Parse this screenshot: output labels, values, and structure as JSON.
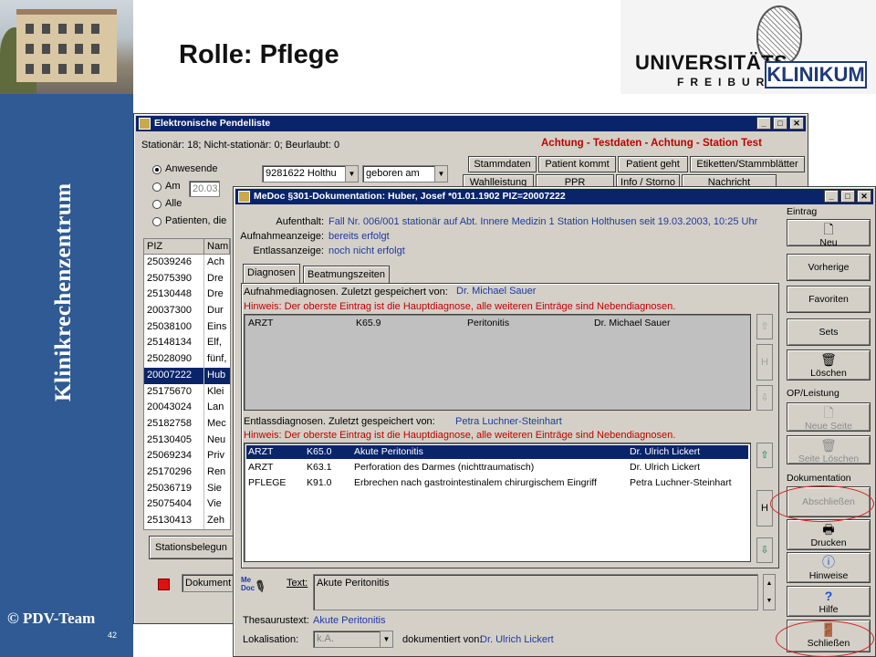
{
  "slide": {
    "title": "Rolle: Pflege",
    "side_title": "Klinikrechenzentrum",
    "copyright": "© PDV-Team",
    "page_number": "42",
    "logo": {
      "line1": "UNIVERSITÄTS",
      "line2": "FREIBURG",
      "line3": "KLINIKUM"
    }
  },
  "pendel": {
    "title": "Elektronische Pendelliste",
    "stats": "Stationär: 18; Nicht-stationär: 0; Beurlaubt: 0",
    "warning": "Achtung - Testdaten - Achtung - Station Test",
    "filter": {
      "options": [
        "Anwesende",
        "Am",
        "Alle",
        "Patienten, die"
      ],
      "date_value": "20.03.",
      "combo1": "9281622 Holthu",
      "combo2": "geboren am"
    },
    "tabs_row1": [
      "Stammdaten",
      "Patient kommt",
      "Patient geht",
      "Etiketten/Stammblätter"
    ],
    "tabs_row2": [
      "Wahlleistung",
      "PPR",
      "Info / Storno",
      "Nachricht"
    ],
    "list_headers": [
      "PIZ",
      "Nam"
    ],
    "rows": [
      {
        "piz": "25039246",
        "name": "Ach"
      },
      {
        "piz": "25075390",
        "name": "Dre"
      },
      {
        "piz": "25130448",
        "name": "Dre"
      },
      {
        "piz": "20037300",
        "name": "Dur"
      },
      {
        "piz": "25038100",
        "name": "Eins"
      },
      {
        "piz": "25148134",
        "name": "Elf,"
      },
      {
        "piz": "25028090",
        "name": "fünf,"
      },
      {
        "piz": "20007222",
        "name": "Hub"
      },
      {
        "piz": "25175670",
        "name": "Klei"
      },
      {
        "piz": "20043024",
        "name": "Lan"
      },
      {
        "piz": "25182758",
        "name": "Mec"
      },
      {
        "piz": "25130405",
        "name": "Neu"
      },
      {
        "piz": "25069234",
        "name": "Priv"
      },
      {
        "piz": "25170296",
        "name": "Ren"
      },
      {
        "piz": "25036719",
        "name": "Sie"
      },
      {
        "piz": "25075404",
        "name": "Vie"
      },
      {
        "piz": "25130413",
        "name": "Zeh"
      }
    ],
    "selected_row_index": 7,
    "bottom_button": "Stationsbelegun",
    "document_label": "Dokument"
  },
  "medoc": {
    "title": "MeDoc §301-Dokumentation: Huber, Josef *01.01.1902 PIZ=20007222",
    "aufenthalt_label": "Aufenthalt:",
    "aufenthalt_value": "Fall Nr. 006/001 stationär auf Abt. Innere Medizin 1 Station Holthusen seit 19.03.2003, 10:25 Uhr",
    "aufnahme_label": "Aufnahmeanzeige:",
    "aufnahme_value": "bereits erfolgt",
    "entlass_label": "Entlassanzeige:",
    "entlass_value": "noch nicht erfolgt",
    "tabs": [
      "Diagnosen",
      "Beatmungszeiten"
    ],
    "aufn_header": "Aufnahmediagnosen. Zuletzt gespeichert von:",
    "aufn_saved_by": "Dr. Michael Sauer",
    "hint": "Hinweis: Der oberste Eintrag ist die Hauptdiagnose, alle weiteren Einträge sind Nebendiagnosen.",
    "aufn_rows": [
      {
        "type": "ARZT",
        "code": "K65.9",
        "text": "Peritonitis",
        "doctor": "Dr. Michael Sauer"
      }
    ],
    "entl_header": "Entlassdiagnosen. Zuletzt gespeichert von:",
    "entl_saved_by": "Petra Luchner-Steinhart",
    "entl_rows": [
      {
        "type": "ARZT",
        "code": "K65.0",
        "text": "Akute Peritonitis",
        "doctor": "Dr. Ulrich Lickert"
      },
      {
        "type": "ARZT",
        "code": "K63.1",
        "text": "Perforation des Darmes (nichttraumatisch)",
        "doctor": "Dr. Ulrich Lickert"
      },
      {
        "type": "PFLEGE",
        "code": "K91.0",
        "text": "Erbrechen nach gastrointestinalem chirurgischem Eingriff",
        "doctor": "Petra Luchner-Steinhart"
      }
    ],
    "scroll_mid_label": "H",
    "logo_text": "Me Doc",
    "text_label": "Text:",
    "text_value": "Akute Peritonitis",
    "thesaurus_label": "Thesaurustext:",
    "thesaurus_value": "Akute Peritonitis",
    "lokalisation_label": "Lokalisation:",
    "lokalisation_value": "k.A.",
    "documented_label": "dokumentiert von:",
    "documented_value": "Dr. Ulrich Lickert",
    "sidebar": {
      "group_eintrag": "Eintrag",
      "neu": "Neu",
      "vorherige": "Vorherige",
      "favoriten": "Favoriten",
      "sets": "Sets",
      "loeschen": "Löschen",
      "group_op": "OP/Leistung",
      "neue_seite": "Neue Seite",
      "seite_loeschen": "Seite Löschen",
      "group_doku": "Dokumentation",
      "abschliessen": "Abschließen",
      "drucken": "Drucken",
      "hinweise": "Hinweise",
      "hilfe": "Hilfe",
      "schliessen": "Schließen"
    }
  }
}
